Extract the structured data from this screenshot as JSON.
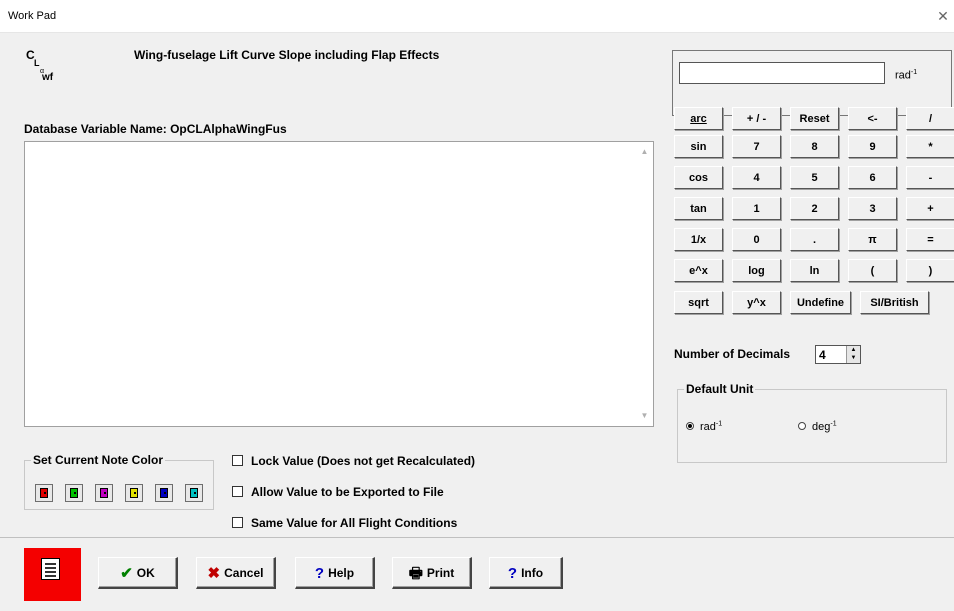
{
  "window": {
    "title": "Work Pad",
    "close_symbol": "✕"
  },
  "variable": {
    "symbol": {
      "c": "C",
      "l": "L",
      "alpha": "α",
      "wf": "wf"
    },
    "title": "Wing-fuselage Lift Curve Slope including Flap Effects",
    "database_label": "Database Variable Name: OpCLAlphaWingFus",
    "notes_text": ""
  },
  "note_color": {
    "label": "Set Current Note Color",
    "colors": [
      "#e00000",
      "#00c000",
      "#c000c0",
      "#e0e000",
      "#0000c0",
      "#00c0c0"
    ]
  },
  "checks": [
    {
      "label": "Lock Value (Does not get Recalculated)",
      "checked": false
    },
    {
      "label": "Allow Value to be Exported to File",
      "checked": false
    },
    {
      "label": "Same Value for All Flight Conditions",
      "checked": false
    }
  ],
  "calculator": {
    "display_value": "",
    "unit": {
      "base": "rad",
      "exp": "-1"
    },
    "rows": [
      [
        "arc",
        "+ / -",
        "Reset",
        "<-",
        "/"
      ],
      [
        "sin",
        "7",
        "8",
        "9",
        "*"
      ],
      [
        "cos",
        "4",
        "5",
        "6",
        "-"
      ],
      [
        "tan",
        "1",
        "2",
        "3",
        "+"
      ],
      [
        "1/x",
        "0",
        ".",
        "π",
        "="
      ],
      [
        "e^x",
        "log",
        "ln",
        "(",
        ")"
      ],
      [
        "sqrt",
        "y^x",
        "Undefine",
        "SI/British"
      ]
    ]
  },
  "decimals": {
    "label": "Number of Decimals",
    "value": "4"
  },
  "default_unit": {
    "label": "Default Unit",
    "options": [
      {
        "base": "rad",
        "exp": "-1",
        "selected": true
      },
      {
        "base": "deg",
        "exp": "-1",
        "selected": false
      }
    ]
  },
  "buttons": {
    "ok": "OK",
    "cancel": "Cancel",
    "help": "Help",
    "print": "Print",
    "info": "Info"
  },
  "icons": {
    "ok": "checkmark-icon",
    "cancel": "x-icon",
    "help": "question-icon",
    "print": "printer-icon",
    "info": "question-icon",
    "notebook": "notebook-icon"
  }
}
